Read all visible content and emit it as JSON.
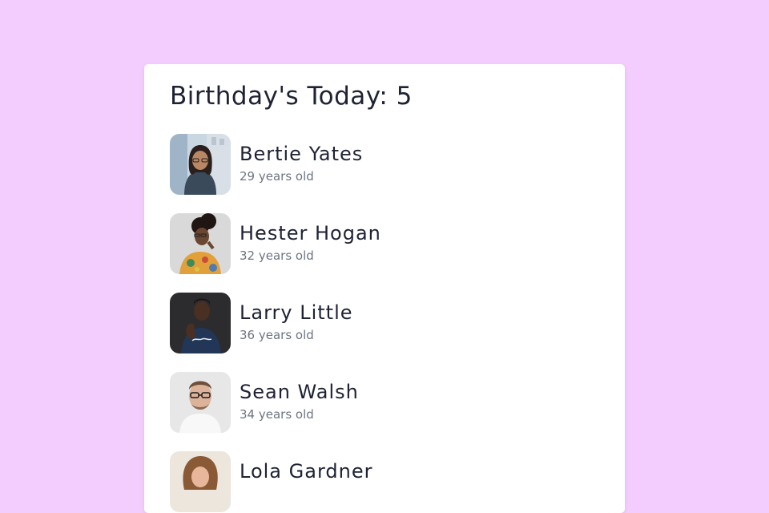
{
  "app": {
    "background_color": "#f3cdfd",
    "card_color": "#ffffff",
    "text_color": "#1e2233",
    "muted_color": "#6f7482"
  },
  "birthdays": {
    "title": "Birthday's Today: 5",
    "people": [
      {
        "name": "Bertie Yates",
        "age_text": "29 years old",
        "avatar_icon": "avatar-photo-woman-glasses"
      },
      {
        "name": "Hester Hogan",
        "age_text": "32 years old",
        "avatar_icon": "avatar-photo-woman-curly-hair"
      },
      {
        "name": "Larry Little",
        "age_text": "36 years old",
        "avatar_icon": "avatar-photo-man-dark-shirt"
      },
      {
        "name": "Sean Walsh",
        "age_text": "34 years old",
        "avatar_icon": "avatar-photo-man-glasses"
      },
      {
        "name": "Lola Gardner",
        "age_text": "",
        "avatar_icon": "avatar-photo-woman-curly-hair"
      }
    ]
  }
}
